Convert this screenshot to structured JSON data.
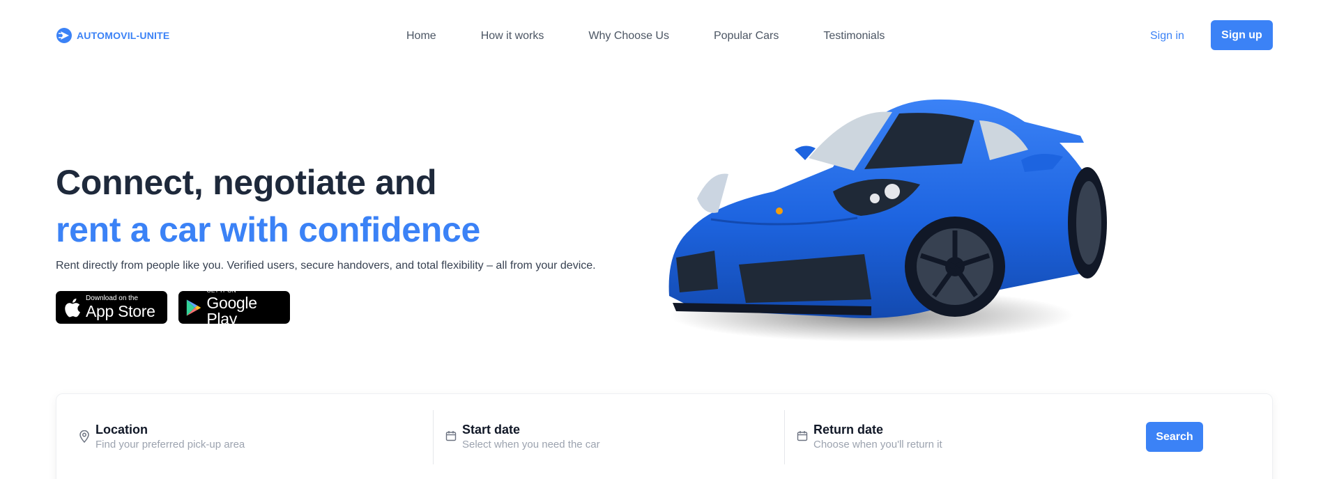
{
  "brand": {
    "name": "AUTOMOVIL-UNITE",
    "color": "#3b82f6"
  },
  "nav": {
    "items": [
      {
        "label": "Home"
      },
      {
        "label": "How it works"
      },
      {
        "label": "Why Choose Us"
      },
      {
        "label": "Popular Cars"
      },
      {
        "label": "Testimonials"
      }
    ],
    "sign_in": "Sign in",
    "sign_up": "Sign up"
  },
  "hero": {
    "headline_line1": "Connect, negotiate and",
    "headline_line2": "rent a car with confidence",
    "subtitle": "Rent directly from people like you. Verified users, secure handovers, and total flexibility – all from your device.",
    "app_store": {
      "small": "Download on the",
      "big": "App Store",
      "icon": "apple-icon"
    },
    "google_play": {
      "small": "GET IT ON",
      "big": "Google Play",
      "icon": "google-play-icon"
    },
    "image": "blue-sports-car"
  },
  "search": {
    "location": {
      "label": "Location",
      "hint": "Find your preferred pick-up area",
      "icon": "map-pin-icon"
    },
    "start_date": {
      "label": "Start date",
      "hint": "Select when you need the car",
      "icon": "calendar-icon"
    },
    "return_date": {
      "label": "Return date",
      "hint": "Choose when you'll return it",
      "icon": "calendar-icon"
    },
    "button": "Search"
  },
  "colors": {
    "accent": "#3b82f6",
    "heading": "#1e293b",
    "muted": "#9ca3af"
  }
}
